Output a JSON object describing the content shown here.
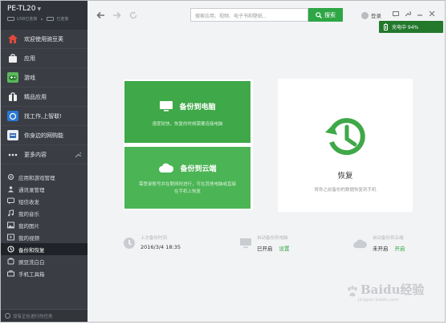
{
  "device": {
    "name": "PE-TL20",
    "status_left": "USB已连接",
    "status_right": "已连接"
  },
  "sidebar": {
    "top_items": [
      {
        "label": "欢迎使用豌豆荚",
        "icon": "home-icon"
      },
      {
        "label": "应用",
        "icon": "bag-icon"
      },
      {
        "label": "游戏",
        "icon": "gamepad-icon"
      },
      {
        "label": "精品应用",
        "icon": "gift-bag-icon"
      },
      {
        "label": "找工作,上智联!",
        "icon": "job-app-icon"
      },
      {
        "label": "你身边的网购能",
        "icon": "shopping-app-icon"
      },
      {
        "label": "更多内容",
        "icon": "more-dots-icon"
      }
    ],
    "sub_items": [
      {
        "label": "应用和游戏管理",
        "icon": "gear-icon"
      },
      {
        "label": "通讯录管理",
        "icon": "contacts-icon"
      },
      {
        "label": "短信收发",
        "icon": "message-icon"
      },
      {
        "label": "我的音乐",
        "icon": "music-icon"
      },
      {
        "label": "我的图片",
        "icon": "image-icon"
      },
      {
        "label": "我的视频",
        "icon": "video-icon"
      },
      {
        "label": "备份和恢复",
        "icon": "backup-icon",
        "active": true
      },
      {
        "label": "豌豆洗白白",
        "icon": "clean-icon"
      },
      {
        "label": "手机工具箱",
        "icon": "toolbox-icon"
      }
    ],
    "task_status": "没有正在进行的任务"
  },
  "toolbar": {
    "search_placeholder": "搜索应用、视频、电子书和壁纸...",
    "search_label": "搜索",
    "login_label": "登录"
  },
  "charge": {
    "text": "充电中 94%",
    "level": 0.94
  },
  "backup": {
    "pc_title": "备份到电脑",
    "pc_desc": "速度较快，恢复的时候需要连接电脑",
    "cloud_title": "备份到云端",
    "cloud_desc": "需登录账号并在联网时进行，可在其他电脑或直接在手机上恢复"
  },
  "restore": {
    "title": "恢复",
    "desc": "将你之前备份的数据恢复到手机"
  },
  "stats": {
    "last_backup_label": "上次备份时间",
    "last_backup_value": "2016/3/4 18:35",
    "auto_pc_label": "自动备份到电脑",
    "auto_pc_value": "已开启",
    "auto_pc_action": "设置",
    "auto_cloud_label": "自动备份到云端",
    "auto_cloud_value": "未开启",
    "auto_cloud_action": "开启"
  },
  "watermark": {
    "text": "Baidu经验",
    "url": "jingyan.baidu.com"
  },
  "colors": {
    "sidebar_bg": "#3a3e44",
    "accent_green": "#3fa848",
    "charge_green": "#23782c"
  }
}
